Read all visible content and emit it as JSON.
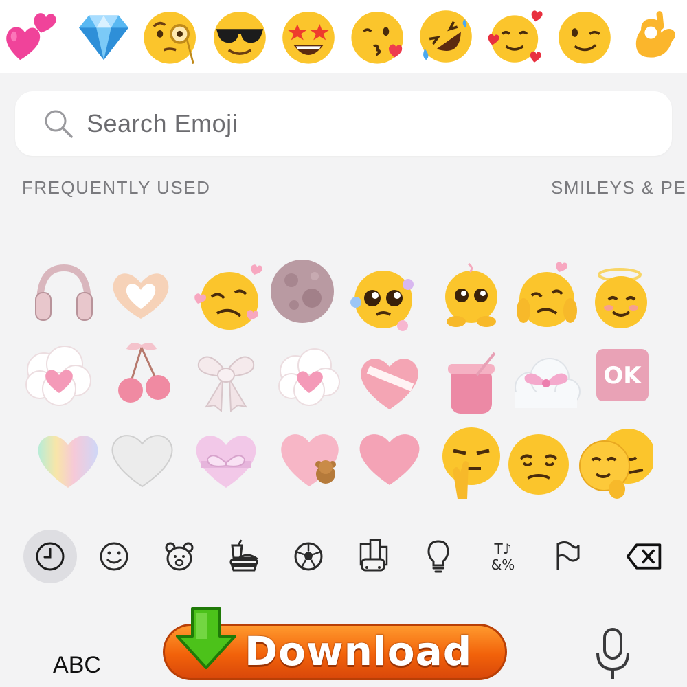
{
  "top_bar": {
    "emojis": [
      "two-hearts",
      "gem",
      "face-with-monocle",
      "smiling-face-with-sunglasses",
      "star-struck",
      "face-blowing-a-kiss",
      "rolling-on-the-floor-laughing",
      "smiling-face-with-hearts",
      "winking-face",
      "ok-hand"
    ]
  },
  "search": {
    "placeholder": "Search Emoji"
  },
  "sections": {
    "frequently_used": "FREQUENTLY USED",
    "smileys": "SMILEYS & PE"
  },
  "grid": {
    "rows": [
      [
        "pink-headphones",
        "heart-hands",
        "woozy-face-with-hearts",
        "pink-moon",
        "pleading-face-with-flowers",
        "pleading-face-holding-back",
        "shy-face-with-hearts",
        "smiling-face-with-halo-hearts"
      ],
      [
        "cloud-with-heart",
        "cherries-with-bow",
        "white-bow",
        "cloud-with-heart-2",
        "mended-heart",
        "honey-pot-pink",
        "cloud-with-pink-bow",
        "ok-button"
      ],
      [
        "rainbow-heart",
        "white-heart",
        "heart-with-bow",
        "pink-heart-with-teddy",
        "pink-heart",
        "peace-face",
        "exhausted-face",
        "hugging-faces"
      ]
    ],
    "ok_text": "OK"
  },
  "categories": {
    "items": [
      "recent-clock",
      "smileys",
      "animals",
      "food",
      "activity",
      "travel",
      "objects",
      "symbols",
      "flags"
    ],
    "active": "recent-clock",
    "symbols_glyph_top": "T♪",
    "symbols_glyph_bottom": "&%"
  },
  "bottom": {
    "abc_label": "ABC",
    "download_label": "Download"
  },
  "colors": {
    "accent_orange": "#f2620a",
    "arrow_green": "#4cc21a",
    "emoji_yellow": "#fbc52c",
    "pink": "#f4a9bd"
  }
}
